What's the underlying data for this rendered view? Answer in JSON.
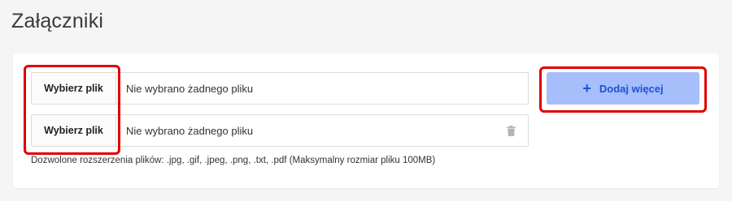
{
  "page": {
    "title": "Załączniki"
  },
  "files": [
    {
      "choose_label": "Wybierz plik",
      "status": "Nie wybrano żadnego pliku",
      "removable": false
    },
    {
      "choose_label": "Wybierz plik",
      "status": "Nie wybrano żadnego pliku",
      "removable": true,
      "remove_icon": "trash-icon"
    }
  ],
  "actions": {
    "add_more_label": "Dodaj więcej",
    "add_more_icon": "plus-icon"
  },
  "note": {
    "allowed_extensions": "Dozwolone rozszerzenia plików: .jpg, .gif, .jpeg, .png, .txt, .pdf (Maksymalny rozmiar pliku 100MB)"
  },
  "colors": {
    "highlight": "#e00000",
    "add_button_bg": "#a6befa",
    "add_button_text": "#1f50d6"
  }
}
